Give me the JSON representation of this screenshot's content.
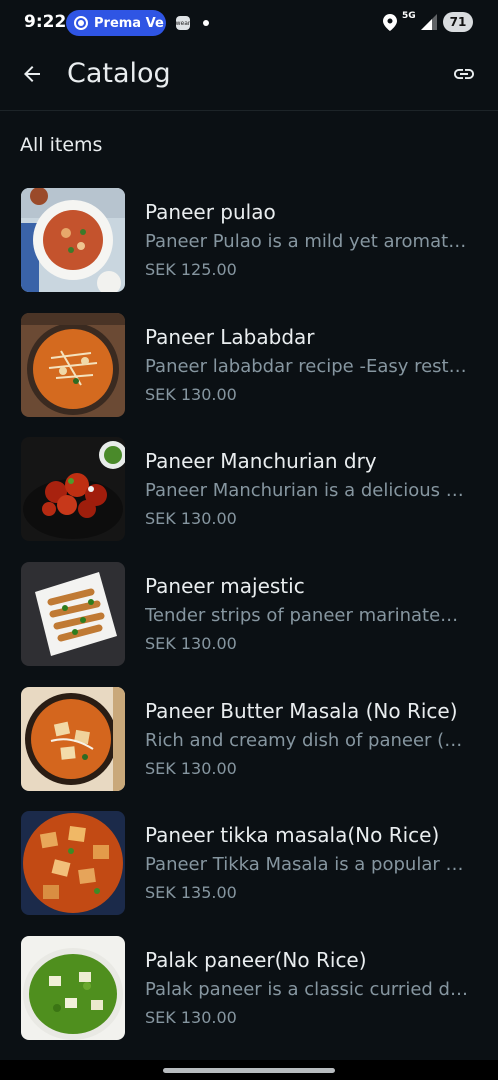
{
  "status_bar": {
    "time": "9:22",
    "pill_text": "Prema Ve",
    "small_app_label": "wear",
    "network": "5G",
    "battery": "71"
  },
  "app_bar": {
    "title": "Catalog",
    "back_icon": "arrow-left-icon",
    "link_icon": "link-icon"
  },
  "section": {
    "header": "All items"
  },
  "items": [
    {
      "name": "Paneer pulao",
      "description": "Paneer Pulao is a mild yet aromatic rice dish",
      "price": "SEK 125.00",
      "image": "paneer-pulao"
    },
    {
      "name": "Paneer Lababdar",
      "description": "Paneer lababdar recipe -Easy restaurant style",
      "price": "SEK 130.00",
      "image": "paneer-lababdar"
    },
    {
      "name": "Paneer Manchurian dry",
      "description": "Paneer Manchurian is a delicious Indo-Chinese",
      "price": "SEK 130.00",
      "image": "paneer-manchurian"
    },
    {
      "name": "Paneer majestic",
      "description": "Tender strips of paneer marinated and fried",
      "price": "SEK 130.00",
      "image": "paneer-majestic"
    },
    {
      "name": "Paneer Butter Masala (No Rice)",
      "description": "Rich and creamy dish of paneer (cottage cheese)",
      "price": "SEK 130.00",
      "image": "paneer-butter-masala"
    },
    {
      "name": "Paneer tikka masala(No Rice)",
      "description": "Paneer Tikka Masala is a popular Indian dish",
      "price": "SEK 135.00",
      "image": "paneer-tikka-masala"
    },
    {
      "name": "Palak paneer(No Rice)",
      "description": "Palak paneer is a classic curried dish",
      "price": "SEK 130.00",
      "image": "palak-paneer"
    }
  ],
  "colors": {
    "background": "#0b1014",
    "text_primary": "#e9edef",
    "text_secondary": "#8696a0",
    "status_pill": "#2f55e4"
  }
}
